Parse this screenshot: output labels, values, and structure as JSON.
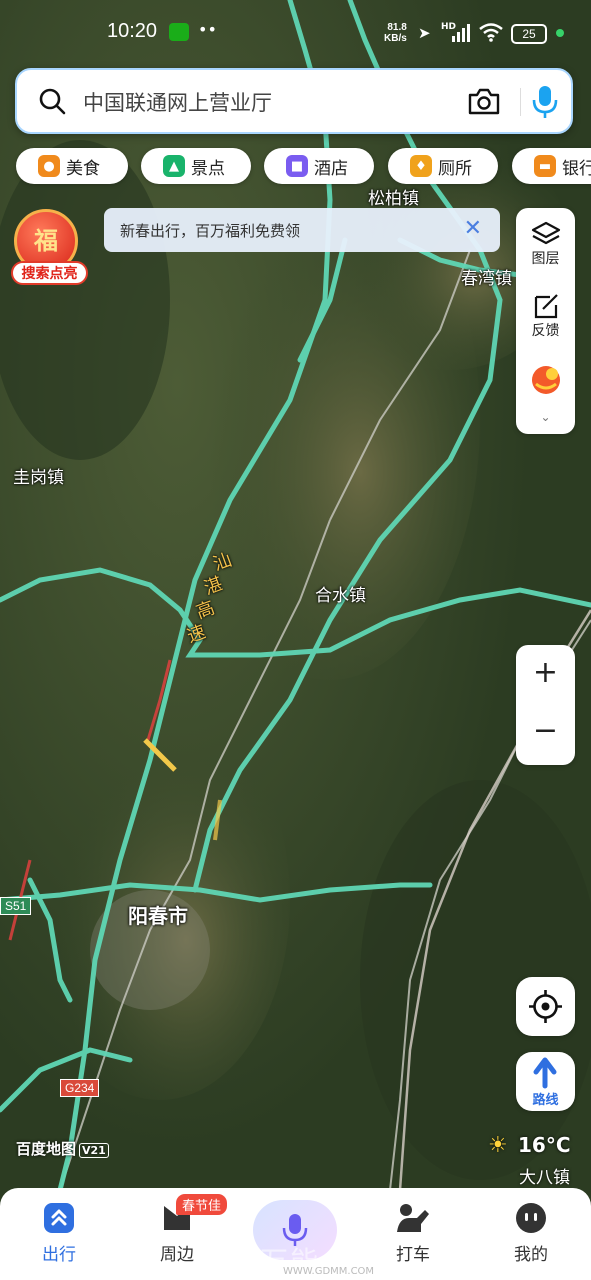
{
  "status_bar": {
    "time": "10:20",
    "net_speed_value": "81.8",
    "net_speed_unit": "KB/s",
    "hd_label": "HD",
    "battery": "25"
  },
  "search": {
    "placeholder": "中国联通网上营业厅"
  },
  "categories": [
    {
      "label": "美食",
      "icon": "food-icon",
      "color": "#f08a1c"
    },
    {
      "label": "景点",
      "icon": "scenic-icon",
      "color": "#19b36b"
    },
    {
      "label": "酒店",
      "icon": "hotel-icon",
      "color": "#7a5cf0"
    },
    {
      "label": "厕所",
      "icon": "toilet-icon",
      "color": "#f0a21c"
    },
    {
      "label": "银行",
      "icon": "bank-icon",
      "color": "#f08a1c"
    }
  ],
  "promo": {
    "fu_char": "福",
    "fu_label": "搜索点亮",
    "banner_text": "新春出行，百万福利免费领"
  },
  "right_tools": {
    "layers_label": "图层",
    "feedback_label": "反馈"
  },
  "map_labels": {
    "songbai": "松柏镇",
    "chunwan": "春湾镇",
    "zhugang": "圭岗镇",
    "expressway": [
      "汕",
      "湛",
      "高",
      "速"
    ],
    "heshui": "合水镇",
    "yangchun": "阳春市",
    "s51": "S51",
    "g234": "G234"
  },
  "map_brand": {
    "name": "百度地图",
    "version": "V21"
  },
  "weather": {
    "temp": "16°C",
    "place": "大八镇"
  },
  "tabbar": {
    "tabs": [
      {
        "label": "出行"
      },
      {
        "label": "周边"
      },
      {
        "label": ""
      },
      {
        "label": "打车"
      },
      {
        "label": "我的"
      }
    ],
    "badge": "春节佳"
  },
  "watermark": {
    "text": "广东万能",
    "url": "WWW.GDMM.COM"
  },
  "colors": {
    "accent": "#2f6fe0",
    "road": "#5fd6b4",
    "badge": "#f04a3c"
  }
}
